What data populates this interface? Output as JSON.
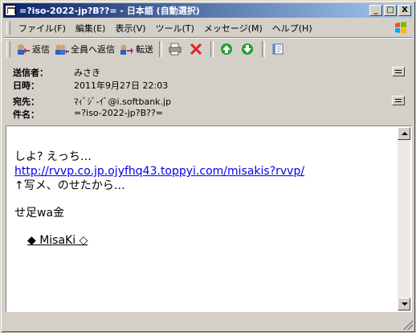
{
  "window": {
    "title": "=?iso-2022-jp?B??= - 日本語 (自動選択)",
    "minimize": "_",
    "maximize": "□",
    "close": "X"
  },
  "menu": [
    "ファイル(F)",
    "編集(E)",
    "表示(V)",
    "ツール(T)",
    "メッセージ(M)",
    "ヘルプ(H)"
  ],
  "toolbar": {
    "reply": "返信",
    "reply_all": "全員へ返信",
    "forward": "転送"
  },
  "header": {
    "from_label": "送信者：",
    "from_value": "みさき",
    "date_label": "日時：",
    "date_value": "2011年9月27日 22:03",
    "to_label": "宛先：",
    "to_value": "ﾏｨﾞｼﾞ-ｲﾞ@i.softbank.jp",
    "subject_label": "件名：",
    "subject_value": "=?iso-2022-jp?B??="
  },
  "body": {
    "line1": "しよ? えっち…",
    "link": "http://rvvp.co.jp.ojyfhq43.toppyi.com/misakis?rvvp/",
    "line3": "↑写メ、のせたから…",
    "line4": "せ足wa金",
    "signature": "◆ MisaKi ◇"
  },
  "colors": {
    "title_start": "#0a246a",
    "title_end": "#a6caf0",
    "link": "#0000ee"
  }
}
